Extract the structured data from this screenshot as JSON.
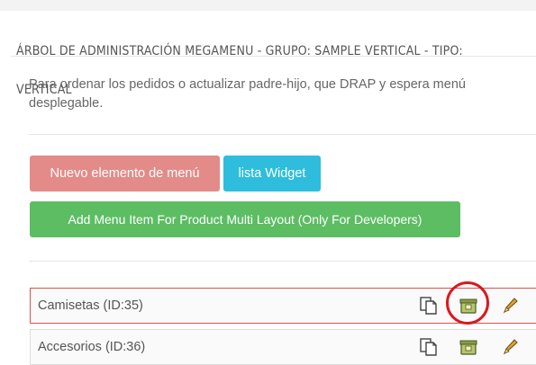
{
  "header": {
    "title": "ÁRBOL DE ADMINISTRACIÓN MEGAMENU - GRUPO: SAMPLE VERTICAL - TIPO: VERTICAL"
  },
  "hint": "Para ordenar los pedidos o actualizar padre-hijo, que DRAP y espera menú desplegable.",
  "buttons": {
    "new_item": "Nuevo elemento de menú",
    "widget_list": "lista Widget",
    "add_product_item": "Add Menu Item For Product Multi Layout (Only For Developers)"
  },
  "menu_items": [
    {
      "label": "Camisetas (ID:35)",
      "selected": true
    },
    {
      "label": "Accesorios (ID:36)",
      "selected": false
    }
  ],
  "colors": {
    "new_button": "#e38b88",
    "widget_button": "#2ebddc",
    "product_button": "#5cbd63",
    "selected_border": "#d9534f",
    "annotation_circle": "#d9191e"
  },
  "icons": [
    "duplicate-icon",
    "widget-icon",
    "pencil-icon"
  ]
}
